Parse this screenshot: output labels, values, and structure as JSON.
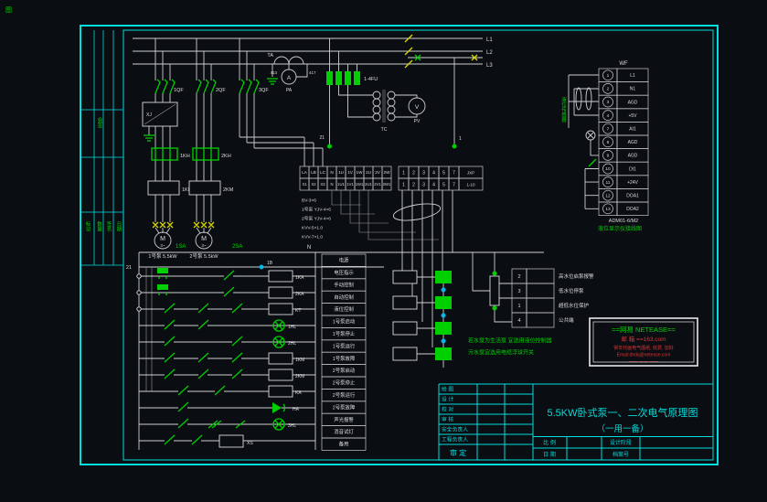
{
  "corner_mark": "图",
  "revision_strip": {
    "top_label": "会签",
    "cols": [
      "标记",
      "数量",
      "签名",
      "日期"
    ]
  },
  "power": {
    "bus_labels": [
      "L1",
      "L2",
      "L3"
    ],
    "breakers": [
      "1QF",
      "2QF",
      "3QF"
    ],
    "relay_label": "XJ",
    "thermals": [
      "1KH",
      "2KH"
    ],
    "contactors": [
      "1KM",
      "2KM"
    ],
    "ct": "TA",
    "ammeter": "A",
    "ammeter_name": "PA",
    "wire_left": "413",
    "wire_right": "417",
    "fuses": "1-4FU",
    "transformer": "TC",
    "voltmeter": "V",
    "voltmeter_name": "PV",
    "wire_21": "21",
    "wire_1": "1",
    "motor_symbol": "M",
    "motor_sub": "3~",
    "motor1_label": "1号泵 5.5kW",
    "motor2_label": "2号泵 5.5kW"
  },
  "strips": {
    "a_row1": [
      "LA",
      "LB",
      "LC",
      "N",
      "1U",
      "1V",
      "1W",
      "2U",
      "2V",
      "2W"
    ],
    "a_row2": [
      "X1",
      "X2",
      "X3",
      "N",
      "1U1",
      "1V1",
      "1W1",
      "2U1",
      "2V1",
      "2W1"
    ],
    "b_row1": [
      "1",
      "2",
      "3",
      "4",
      "5",
      "7"
    ],
    "b_row2": [
      "1",
      "2",
      "3",
      "4",
      "5",
      "7"
    ],
    "b_wide_top": "JXP",
    "b_wide_bottom": "1-10",
    "cables": [
      "BV-3×6",
      "1号泵 YJV-4×6",
      "2号泵 YJV-4×6",
      "KVV-5×1.0",
      "KVV-7×1.0"
    ]
  },
  "ladder": {
    "sa1": "1SA",
    "sa2": "2SA",
    "neutral": "N",
    "node": "1B",
    "wire": "21",
    "coils": [
      "1KA",
      "2KA",
      "KT",
      "1HL",
      "2HL",
      "1KM",
      "2KM",
      "KA",
      "HA",
      "3HL",
      "XS"
    ]
  },
  "ladder_table": {
    "rows": [
      "电源",
      "电压指示",
      "手动控制",
      "自动控制",
      "液位控制",
      "1号泵启动",
      "1号泵停止",
      "1号泵运行",
      "1号泵故障",
      "2号泵启动",
      "2号泵停止",
      "2号泵运行",
      "2号泵故障",
      "声光报警",
      "消音试灯",
      "备用"
    ]
  },
  "instrument": {
    "header": "WF",
    "numbers": [
      "1",
      "2",
      "3",
      "4",
      "7",
      "8",
      "9",
      "10",
      "11",
      "12",
      "13"
    ],
    "labels": [
      "L1",
      "N1",
      "AGD",
      "+5V",
      "AI1",
      "AGD",
      "AGD",
      "DI1",
      "+24V",
      "DOA1",
      "DOA2"
    ],
    "model": "ADM01-6/M2",
    "caption": "液位显示仪接线图",
    "sensor_label": "液位传感器"
  },
  "float_box": {
    "numbers": [
      "2",
      "3",
      "1",
      "4"
    ],
    "labels": [
      "高水位启泵报警",
      "低水位停泵",
      "超低水位保护",
      "公共端"
    ],
    "notes": [
      "若水泵为生活泵 宜选用液位控制器",
      "污水泵宜选用电缆浮球开关"
    ]
  },
  "watermark": {
    "line1": "==网易 NETEASE==",
    "line2": "邮 箱 ==163.com",
    "line3": "常年代画电气图纸, 收费, 加好",
    "line4": "Email:dhdq@netease.com",
    "line5": "—— —— ——"
  },
  "title_block": {
    "rows": [
      "绘 图",
      "设 计",
      "校 对",
      "审 核",
      "安全负责人",
      "工程负责人"
    ],
    "approve": "审 定",
    "title_line1": "5.5KW卧式泵一、二次电气原理图",
    "title_line2": "（一用一备）",
    "scale": "比 例",
    "date": "日 期",
    "stage": "设计阶段",
    "archive": "档案号"
  }
}
